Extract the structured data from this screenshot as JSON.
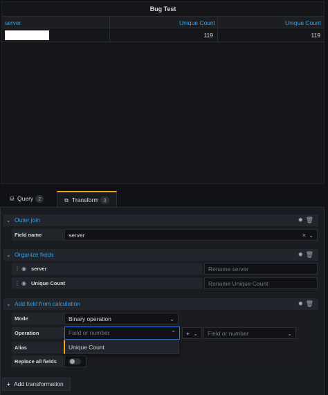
{
  "panel": {
    "title": "Bug Test",
    "columns": [
      "server",
      "Unique Count",
      "Unique Count"
    ],
    "rows": [
      {
        "server": "",
        "count1": "119",
        "count2": "119"
      }
    ]
  },
  "tabs": [
    {
      "label": "Query",
      "count": "2",
      "icon": "database-icon"
    },
    {
      "label": "Transform",
      "count": "3",
      "icon": "transform-icon",
      "active": true
    }
  ],
  "outer_join": {
    "title": "Outer join",
    "field_name_label": "Field name",
    "field_name_value": "server"
  },
  "organize_fields": {
    "title": "Organize fields",
    "fields": [
      {
        "name": "server",
        "rename_placeholder": "Rename server"
      },
      {
        "name": "Unique Count",
        "rename_placeholder": "Rename Unique Count"
      }
    ]
  },
  "add_field": {
    "title": "Add field from calculation",
    "mode_label": "Mode",
    "mode_value": "Binary operation",
    "operation_label": "Operation",
    "left_placeholder": "Field or number",
    "operator": "+",
    "right_placeholder": "Field or number",
    "alias_label": "Alias",
    "replace_label": "Replace all fields",
    "dropdown_option": "Unique Count"
  },
  "add_transformation_label": "Add transformation",
  "colors": {
    "accent": "#33a2e5",
    "active_tab": "#f5a623",
    "focus": "#3274d9"
  }
}
